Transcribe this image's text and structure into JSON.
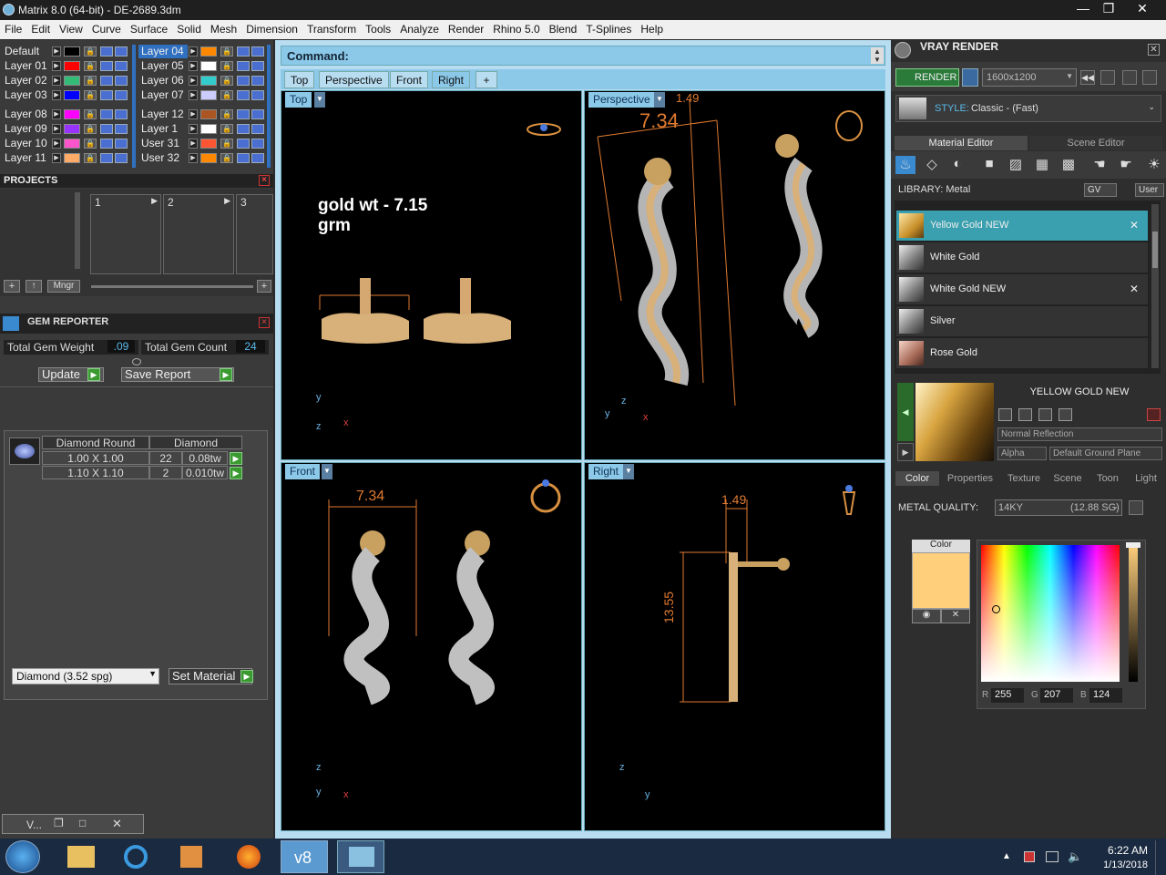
{
  "window": {
    "title": "Matrix 8.0 (64-bit) - DE-2689.3dm",
    "minimize": "—",
    "maximize": "❐",
    "close": "✕"
  },
  "menu": [
    "File",
    "Edit",
    "View",
    "Curve",
    "Surface",
    "Solid",
    "Mesh",
    "Dimension",
    "Transform",
    "Tools",
    "Analyze",
    "Render",
    "Rhino 5.0",
    "Blend",
    "T-Splines",
    "Help"
  ],
  "layers": {
    "left": [
      {
        "name": "Default",
        "color": "#000000"
      },
      {
        "name": "Layer 01",
        "color": "#ff0000"
      },
      {
        "name": "Layer 02",
        "color": "#33bb77"
      },
      {
        "name": "Layer 03",
        "color": "#0000ff"
      },
      {
        "name": "Layer 08",
        "color": "#ff00ff"
      },
      {
        "name": "Layer 09",
        "color": "#9933ff"
      },
      {
        "name": "Layer 10",
        "color": "#ff55cc"
      },
      {
        "name": "Layer 11",
        "color": "#ffaa66"
      }
    ],
    "right": [
      {
        "name": "Layer 04",
        "color": "#ff8800"
      },
      {
        "name": "Layer 05",
        "color": "#ffffff"
      },
      {
        "name": "Layer 06",
        "color": "#33cccc"
      },
      {
        "name": "Layer 07",
        "color": "#ccccff"
      },
      {
        "name": "Layer 12",
        "color": "#aa5522"
      },
      {
        "name": "Layer 1",
        "color": "#ffffff"
      },
      {
        "name": "User 31",
        "color": "#ff5533"
      },
      {
        "name": "User 32",
        "color": "#ff8800"
      }
    ]
  },
  "projects": {
    "title": "PROJECTS",
    "slots": [
      "1",
      "2",
      "3"
    ],
    "mngr": "Mngr"
  },
  "gem_reporter": {
    "title": "GEM REPORTER",
    "total_weight_label": "Total Gem Weight",
    "total_weight": ".09",
    "total_count_label": "Total Gem Count",
    "total_count": "24",
    "update": "Update",
    "save_report": "Save Report",
    "col1": "Diamond Round",
    "col2": "Diamond",
    "rows": [
      {
        "size": "1.00 X 1.00",
        "count": "22",
        "tw": "0.08tw"
      },
      {
        "size": "1.10 X 1.10",
        "count": "2",
        "tw": "0.010tw"
      }
    ],
    "material_select": "Diamond    (3.52 spg)",
    "set_material": "Set Material"
  },
  "command": {
    "label": "Command:"
  },
  "view_tabs": [
    "Top",
    "Perspective",
    "Front",
    "Right",
    "+"
  ],
  "viewports": {
    "top": {
      "label": "Top",
      "note_line1": "gold wt - 7.15",
      "note_line2": "grm"
    },
    "perspective": {
      "label": "Perspective",
      "dim1": "7.34",
      "dim2": "1.49"
    },
    "front": {
      "label": "Front",
      "dim": "7.34"
    },
    "right": {
      "label": "Right",
      "dim_w": "1.49",
      "dim_h": "13.55"
    }
  },
  "vray": {
    "title": "VRAY RENDER",
    "render": "RENDER",
    "resolution": "1600x1200",
    "style_label": "STYLE:",
    "style_value": "Classic - (Fast)",
    "tab_material": "Material Editor",
    "tab_scene": "Scene Editor",
    "library_label": "LIBRARY: Metal",
    "gv": "GV",
    "user": "User",
    "materials": [
      "Yellow Gold NEW",
      "White Gold",
      "White Gold NEW",
      "Silver",
      "Rose Gold"
    ],
    "selected_title": "YELLOW GOLD NEW",
    "reflection": "Normal Reflection",
    "alpha": "Alpha",
    "ground": "Default Ground Plane",
    "tabs": [
      "Color",
      "Properties",
      "Texture",
      "Scene",
      "Toon",
      "Light"
    ],
    "metal_quality_label": "METAL QUALITY:",
    "metal_quality_value": "14KY",
    "metal_quality_sg": "(12.88 SG)",
    "color_label": "Color",
    "r": "255",
    "g": "207",
    "b": "124",
    "swatch": "#ffcf7c"
  },
  "taskbar": {
    "time": "6:22 AM",
    "date": "1/13/2018",
    "mini_window": "V..."
  }
}
